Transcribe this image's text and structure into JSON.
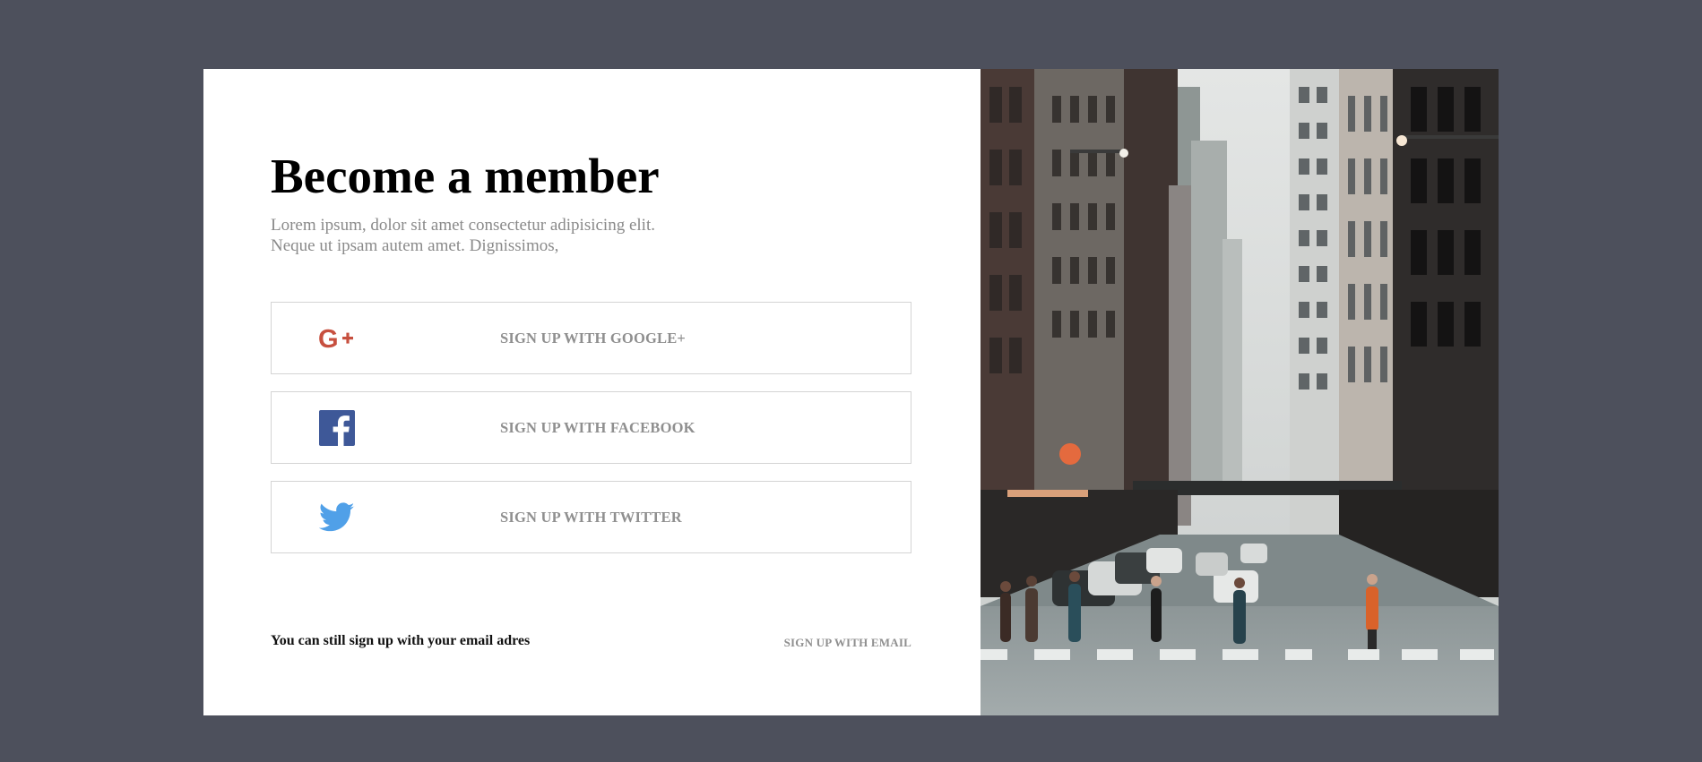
{
  "signup": {
    "title": "Become a member",
    "subtitle": "Lorem ipsum, dolor sit amet consectetur adipisicing elit. Neque ut ipsam autem amet. Dignissimos,",
    "buttons": {
      "google": {
        "label": "SIGN UP WITH GOOGLE+",
        "icon": "google-plus-icon",
        "color": "#c7503f"
      },
      "facebook": {
        "label": "SIGN UP WITH FACEBOOK",
        "icon": "facebook-icon",
        "color": "#3e5898"
      },
      "twitter": {
        "label": "SIGN UP WITH TWITTER",
        "icon": "twitter-icon",
        "color": "#50a0e8"
      }
    },
    "footer_text": "You can still sign up with your email adres",
    "email_link": "SIGN UP WITH EMAIL"
  },
  "colors": {
    "page_background": "#4d505c",
    "card_background": "#ffffff",
    "muted_text": "#8f8f8f"
  },
  "hero_image": {
    "description_icon": "city-street-photo"
  }
}
